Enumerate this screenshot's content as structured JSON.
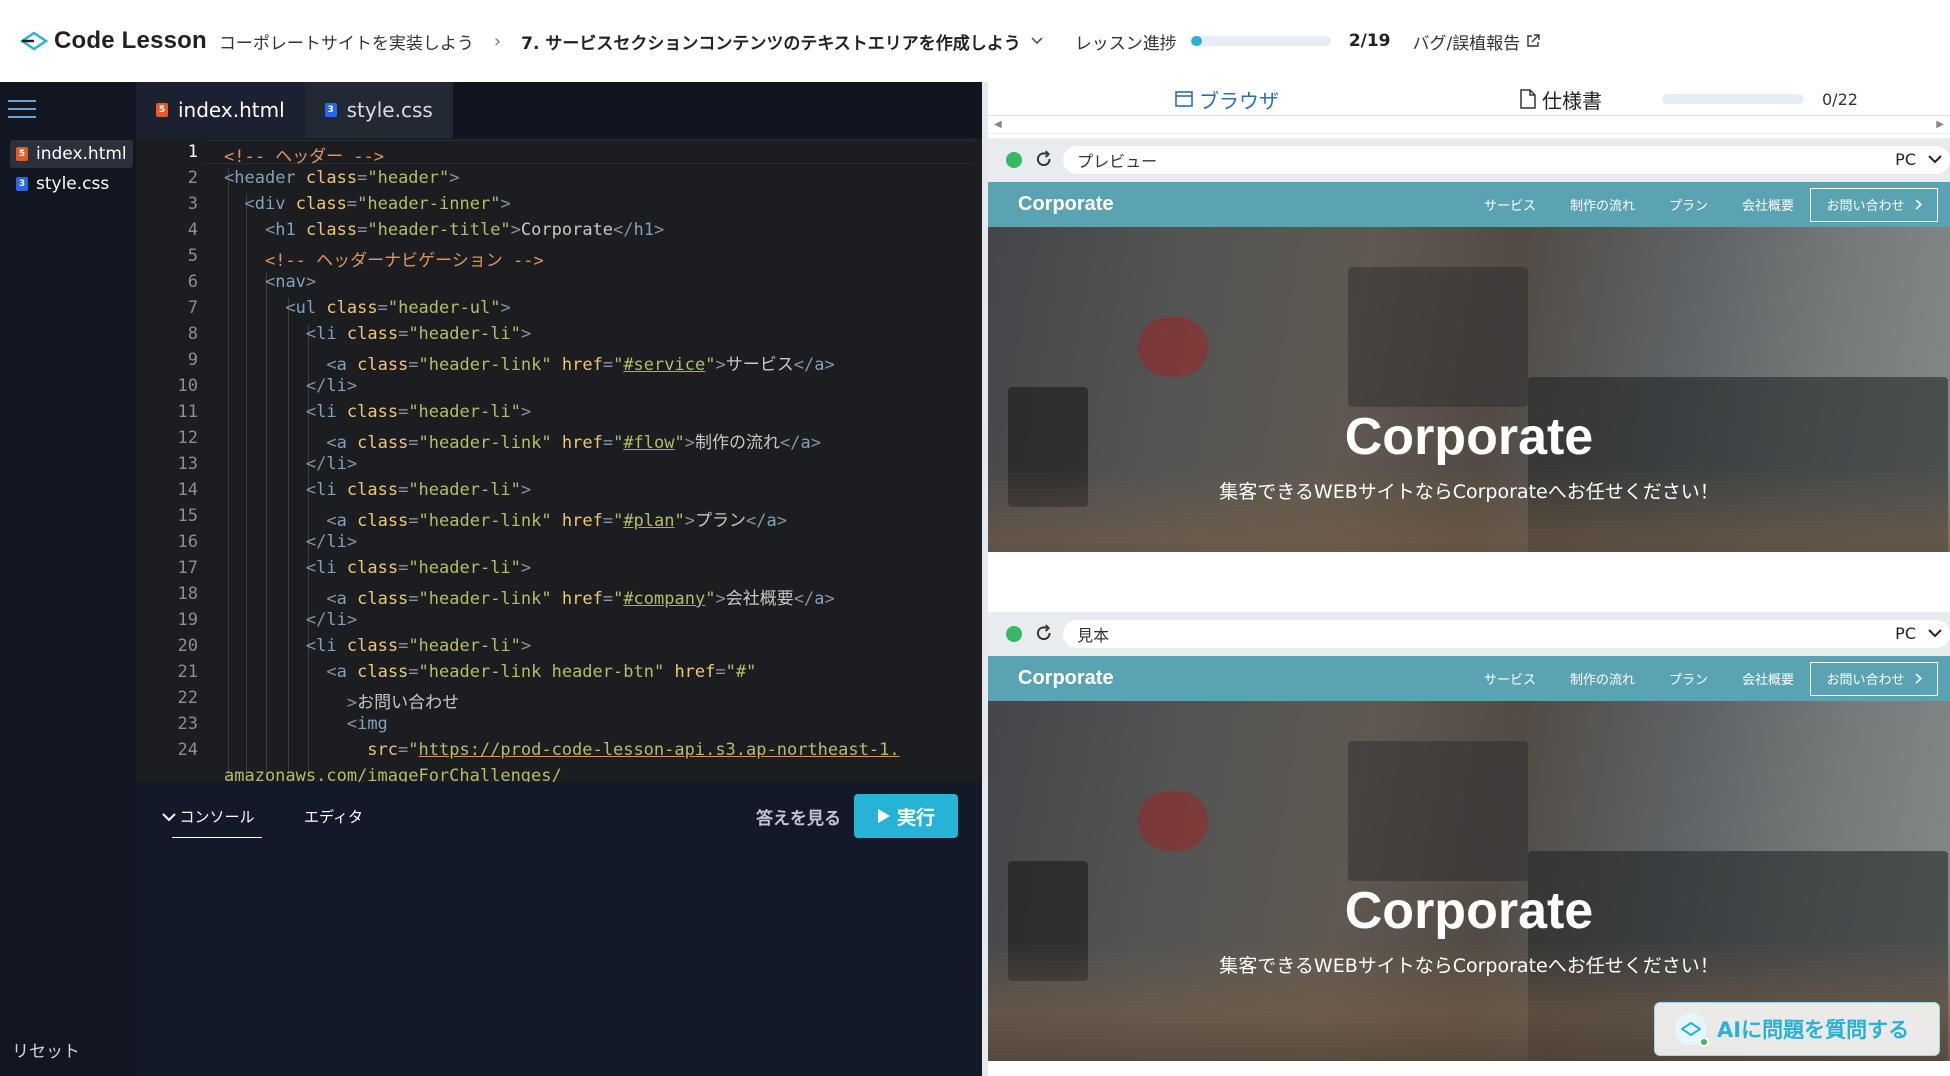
{
  "brand": {
    "name": "Code Lesson",
    "accent": "#27b3d6"
  },
  "header": {
    "course": "コーポレートサイトを実装しよう",
    "lesson": "7. サービスセクションコンテンツのテキストエリアを作成しよう",
    "progress_label": "レッスン進捗",
    "progress_value": 0.08,
    "progress_count": "2/19",
    "bug_report": "バグ/誤植報告"
  },
  "sidebar": {
    "files": [
      {
        "name": "index.html",
        "type": "html"
      },
      {
        "name": "style.css",
        "type": "css"
      }
    ],
    "reset": "リセット"
  },
  "editor": {
    "tabs": [
      {
        "label": "index.html",
        "type": "html"
      },
      {
        "label": "style.css",
        "type": "css"
      }
    ],
    "line_numbers": [
      "1",
      "2",
      "3",
      "4",
      "5",
      "6",
      "7",
      "8",
      "9",
      "10",
      "11",
      "12",
      "13",
      "14",
      "15",
      "16",
      "17",
      "18",
      "19",
      "20",
      "21",
      "22",
      "23",
      "24"
    ]
  },
  "console": {
    "tabs": [
      "コンソール",
      "エディタ"
    ],
    "answer": "答えを見る",
    "run": "実行"
  },
  "right": {
    "tab_browser": "ブラウザ",
    "tab_spec": "仕様書",
    "spec_count": "0/22",
    "preview_label": "プレビュー",
    "sample_label": "見本",
    "device": "PC"
  },
  "site": {
    "logo": "Corporate",
    "nav": [
      "サービス",
      "制作の流れ",
      "プラン",
      "会社概要"
    ],
    "contact": "お問い合わせ",
    "hero_title": "Corporate",
    "hero_sub": "集客できるWEBサイトならCorporateへお任せください！",
    "header_color": "#5aa3b2"
  },
  "ai_button": "AIに問題を質問する"
}
